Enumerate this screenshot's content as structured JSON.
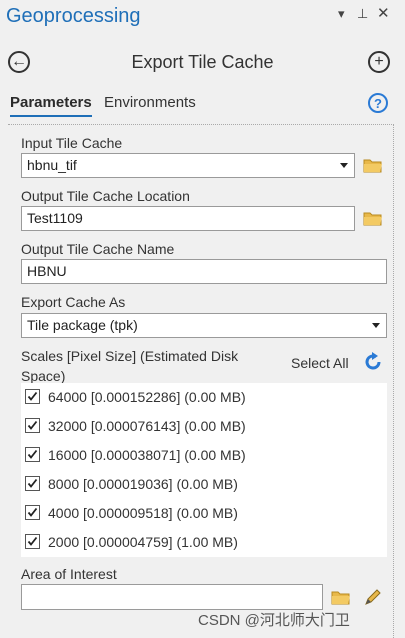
{
  "pane": {
    "title": "Geoprocessing",
    "controls": {
      "menu": "▾",
      "pin": "⊥",
      "close": "✕"
    }
  },
  "tool": {
    "title": "Export Tile Cache",
    "back_icon": "←",
    "add_icon": "+"
  },
  "tabs": {
    "parameters": "Parameters",
    "environments": "Environments",
    "help": "?"
  },
  "params": {
    "input_tile_cache": {
      "label": "Input Tile Cache",
      "value": "hbnu_tif"
    },
    "output_location": {
      "label": "Output Tile Cache Location",
      "value": "Test1109"
    },
    "output_name": {
      "label": "Output Tile Cache Name",
      "value": "HBNU"
    },
    "export_as": {
      "label": "Export Cache As",
      "value": "Tile package (tpk)"
    },
    "scales": {
      "label": "Scales [Pixel Size] (Estimated Disk Space)",
      "select_all": "Select All",
      "items": [
        {
          "text": "64000 [0.000152286] (0.00 MB)",
          "checked": true
        },
        {
          "text": "32000 [0.000076143] (0.00 MB)",
          "checked": true
        },
        {
          "text": "16000 [0.000038071] (0.00 MB)",
          "checked": true
        },
        {
          "text": "8000 [0.000019036] (0.00 MB)",
          "checked": true
        },
        {
          "text": "4000 [0.000009518] (0.00 MB)",
          "checked": true
        },
        {
          "text": "2000 [0.000004759] (1.00 MB)",
          "checked": true
        }
      ]
    },
    "area_of_interest": {
      "label": "Area of Interest",
      "value": ""
    }
  },
  "watermark": "CSDN @河北师大门卫",
  "colors": {
    "accent": "#1f6fb8",
    "folder": "#e8b84a"
  }
}
